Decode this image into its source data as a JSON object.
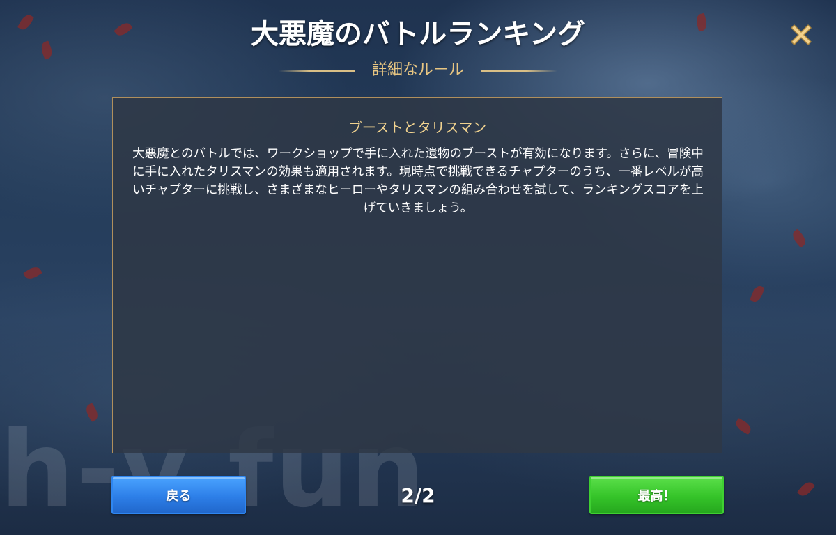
{
  "header": {
    "title": "大悪魔のバトルランキング",
    "subtitle": "詳細なルール"
  },
  "close": {
    "icon": "close-icon",
    "color": "#f2d08a"
  },
  "panel": {
    "heading": "ブーストとタリスマン",
    "body": "大悪魔とのバトルでは、ワークショップで手に入れた遺物のブーストが有効になります。さらに、冒険中に手に入れたタリスマンの効果も適用されます。現時点で挑戦できるチャプターのうち、一番レベルが高いチャプターに挑戦し、さまざまなヒーローやタリスマンの組み合わせを試して、ランキングスコアを上げていきましょう。"
  },
  "footer": {
    "back_label": "戻る",
    "page_indicator": "2/2",
    "best_label": "最高！"
  },
  "watermark": "h-v fun",
  "colors": {
    "accent_gold": "#e8c682",
    "back_button": "#2d7fe8",
    "best_button": "#35c429"
  }
}
